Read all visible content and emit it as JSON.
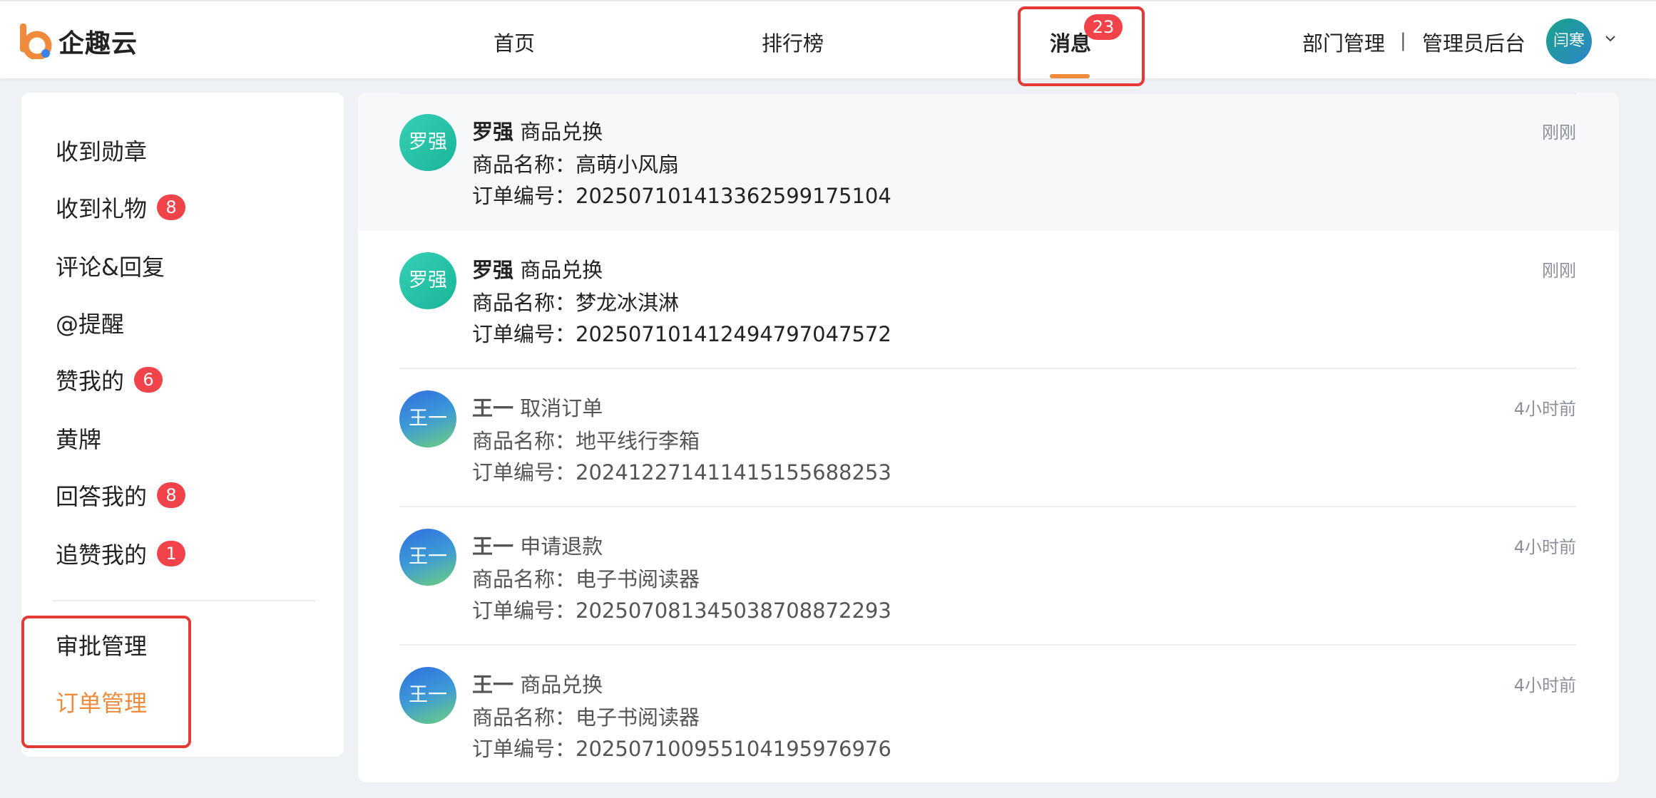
{
  "header": {
    "logo_text": "企趣云",
    "nav": [
      {
        "label": "首页"
      },
      {
        "label": "排行榜"
      },
      {
        "label": "消息",
        "badge": "23",
        "active": true
      }
    ],
    "dept_link": "部门管理",
    "divider": "|",
    "admin_link": "管理员后台",
    "user_avatar": "闫寒"
  },
  "sidebar": {
    "items": [
      {
        "label": "收到勋章",
        "badge": ""
      },
      {
        "label": "收到礼物",
        "badge": "8"
      },
      {
        "label": "评论&回复",
        "badge": ""
      },
      {
        "label": "@提醒",
        "badge": ""
      },
      {
        "label": "赞我的",
        "badge": "6"
      },
      {
        "label": "黄牌",
        "badge": ""
      },
      {
        "label": "回答我的",
        "badge": "8"
      },
      {
        "label": "追赞我的",
        "badge": "1"
      }
    ],
    "mgmt": [
      {
        "label": "审批管理",
        "active": false
      },
      {
        "label": "订单管理",
        "active": true
      }
    ]
  },
  "messages": [
    {
      "avatar": "罗强",
      "name": "罗强",
      "action": "商品兑换",
      "product_label": "商品名称：",
      "product": "高萌小风扇",
      "order_label": "订单编号：",
      "order": "2025071014133625991751​04",
      "time": "刚刚"
    },
    {
      "avatar": "罗强",
      "name": "罗强",
      "action": "商品兑换",
      "product_label": "商品名称：",
      "product": "梦龙冰淇淋",
      "order_label": "订单编号：",
      "order": "20250710141249479704757​2",
      "time": "刚刚"
    },
    {
      "avatar": "王一",
      "name": "王一",
      "action": "取消订单",
      "product_label": "商品名称：",
      "product": "地平线行李箱",
      "order_label": "订单编号：",
      "order": "202412271411415155688253",
      "time": "4小时前"
    },
    {
      "avatar": "王一",
      "name": "王一",
      "action": "申请退款",
      "product_label": "商品名称：",
      "product": "电子书阅读器",
      "order_label": "订单编号：",
      "order": "202507081345038708872293",
      "time": "4小时前"
    },
    {
      "avatar": "王一",
      "name": "王一",
      "action": "商品兑换",
      "product_label": "商品名称：",
      "product": "电子书阅读器",
      "order_label": "订单编号：",
      "order": "202507100955104195976976",
      "time": "4小时前"
    }
  ]
}
